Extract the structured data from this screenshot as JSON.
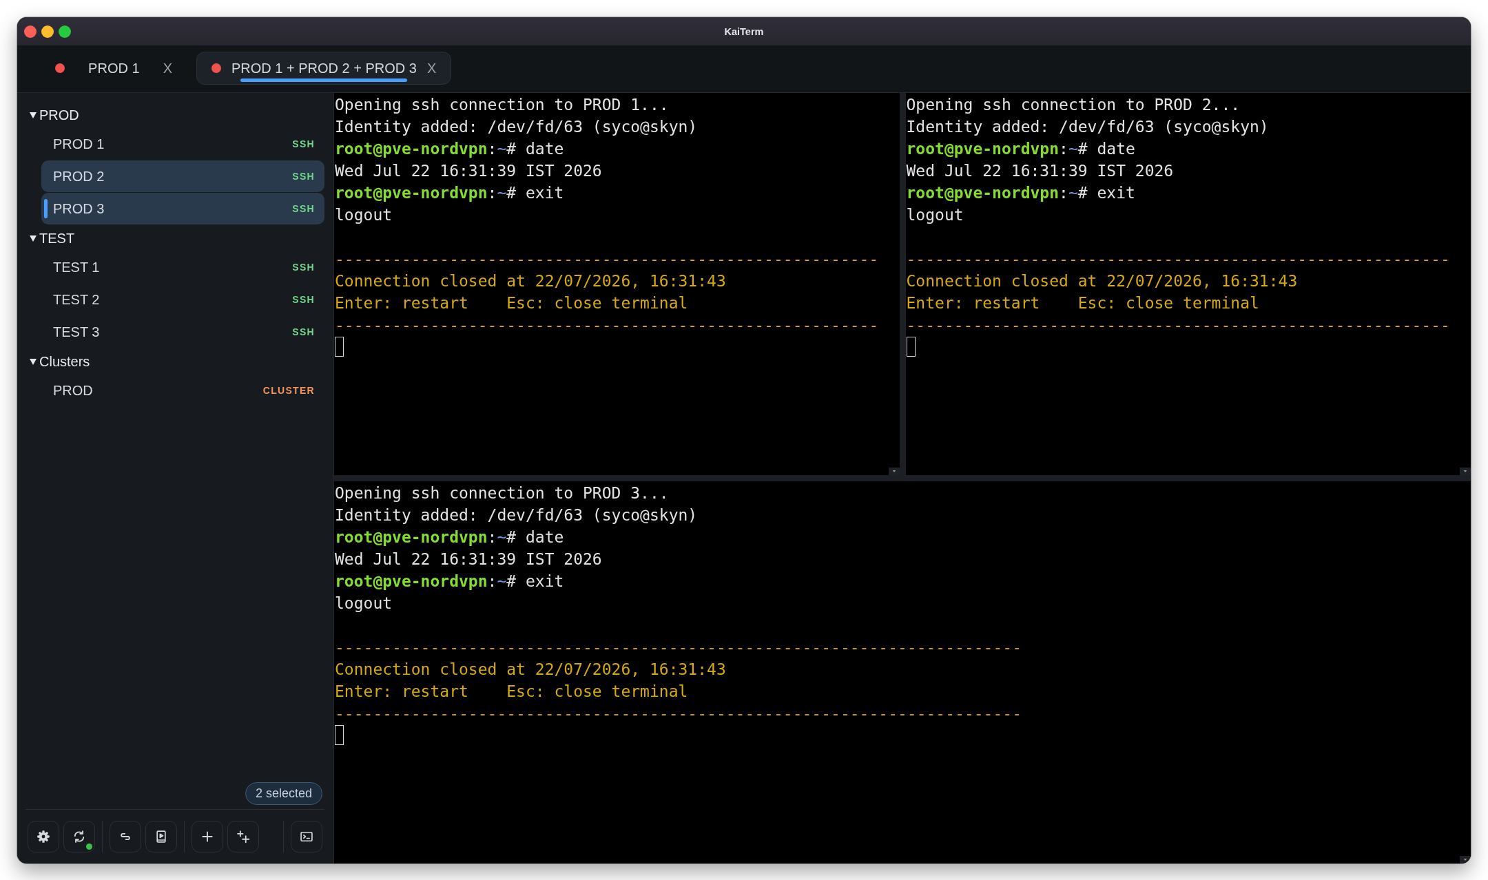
{
  "window": {
    "title": "KaiTerm"
  },
  "tabs": [
    {
      "label": "PROD 1",
      "connected": false,
      "selected": false,
      "close": "X"
    },
    {
      "label": "PROD 1 + PROD 2 + PROD 3",
      "connected": false,
      "selected": true,
      "close": "X"
    }
  ],
  "sidebar": {
    "groups": [
      {
        "label": "PROD",
        "expanded": true,
        "items": [
          {
            "label": "PROD 1",
            "badge": "SSH",
            "kind": "ssh",
            "selected": false,
            "active": false
          },
          {
            "label": "PROD 2",
            "badge": "SSH",
            "kind": "ssh",
            "selected": true,
            "active": false
          },
          {
            "label": "PROD 3",
            "badge": "SSH",
            "kind": "ssh",
            "selected": true,
            "active": true
          }
        ]
      },
      {
        "label": "TEST",
        "expanded": true,
        "items": [
          {
            "label": "TEST 1",
            "badge": "SSH",
            "kind": "ssh",
            "selected": false,
            "active": false
          },
          {
            "label": "TEST 2",
            "badge": "SSH",
            "kind": "ssh",
            "selected": false,
            "active": false
          },
          {
            "label": "TEST 3",
            "badge": "SSH",
            "kind": "ssh",
            "selected": false,
            "active": false
          }
        ]
      },
      {
        "label": "Clusters",
        "expanded": true,
        "items": [
          {
            "label": "PROD",
            "badge": "CLUSTER",
            "kind": "cluster",
            "selected": false,
            "active": false
          }
        ]
      }
    ],
    "selection_badge": "2 selected",
    "toolbar": {
      "sync_online": true
    }
  },
  "panes": [
    {
      "lines": [
        {
          "kind": "text",
          "segments": [
            {
              "kind": "plain",
              "text": "Opening ssh connection to PROD 1..."
            }
          ]
        },
        {
          "kind": "text",
          "segments": [
            {
              "kind": "plain",
              "text": "Identity added: /dev/fd/63 (syco@skyn)"
            }
          ]
        },
        {
          "kind": "text",
          "segments": [
            {
              "kind": "host",
              "text": "root@pve-nordvpn"
            },
            {
              "kind": "plain",
              "text": ":"
            },
            {
              "kind": "path",
              "text": "~"
            },
            {
              "kind": "plain",
              "text": "# date"
            }
          ]
        },
        {
          "kind": "text",
          "segments": [
            {
              "kind": "plain",
              "text": "Wed Jul 22 16:31:39 IST 2026"
            }
          ]
        },
        {
          "kind": "text",
          "segments": [
            {
              "kind": "host",
              "text": "root@pve-nordvpn"
            },
            {
              "kind": "plain",
              "text": ":"
            },
            {
              "kind": "path",
              "text": "~"
            },
            {
              "kind": "plain",
              "text": "# exit"
            }
          ]
        },
        {
          "kind": "text",
          "segments": [
            {
              "kind": "plain",
              "text": "logout"
            }
          ]
        },
        {
          "kind": "blank"
        },
        {
          "kind": "text",
          "segments": [
            {
              "kind": "notice",
              "text": "---------------------------------------------------------"
            }
          ]
        },
        {
          "kind": "text",
          "segments": [
            {
              "kind": "notice",
              "text": "Connection closed at 22/07/2026, 16:31:43"
            }
          ]
        },
        {
          "kind": "text",
          "segments": [
            {
              "kind": "notice",
              "text": "Enter: restart    Esc: close terminal"
            }
          ]
        },
        {
          "kind": "text",
          "segments": [
            {
              "kind": "notice",
              "text": "---------------------------------------------------------"
            }
          ]
        },
        {
          "kind": "cursor"
        }
      ]
    },
    {
      "lines": [
        {
          "kind": "text",
          "segments": [
            {
              "kind": "plain",
              "text": "Opening ssh connection to PROD 2..."
            }
          ]
        },
        {
          "kind": "text",
          "segments": [
            {
              "kind": "plain",
              "text": "Identity added: /dev/fd/63 (syco@skyn)"
            }
          ]
        },
        {
          "kind": "text",
          "segments": [
            {
              "kind": "host",
              "text": "root@pve-nordvpn"
            },
            {
              "kind": "plain",
              "text": ":"
            },
            {
              "kind": "path",
              "text": "~"
            },
            {
              "kind": "plain",
              "text": "# date"
            }
          ]
        },
        {
          "kind": "text",
          "segments": [
            {
              "kind": "plain",
              "text": "Wed Jul 22 16:31:39 IST 2026"
            }
          ]
        },
        {
          "kind": "text",
          "segments": [
            {
              "kind": "host",
              "text": "root@pve-nordvpn"
            },
            {
              "kind": "plain",
              "text": ":"
            },
            {
              "kind": "path",
              "text": "~"
            },
            {
              "kind": "plain",
              "text": "# exit"
            }
          ]
        },
        {
          "kind": "text",
          "segments": [
            {
              "kind": "plain",
              "text": "logout"
            }
          ]
        },
        {
          "kind": "blank"
        },
        {
          "kind": "text",
          "segments": [
            {
              "kind": "notice",
              "text": "---------------------------------------------------------"
            }
          ]
        },
        {
          "kind": "text",
          "segments": [
            {
              "kind": "notice",
              "text": "Connection closed at 22/07/2026, 16:31:43"
            }
          ]
        },
        {
          "kind": "text",
          "segments": [
            {
              "kind": "notice",
              "text": "Enter: restart    Esc: close terminal"
            }
          ]
        },
        {
          "kind": "text",
          "segments": [
            {
              "kind": "notice",
              "text": "---------------------------------------------------------"
            }
          ]
        },
        {
          "kind": "cursor"
        }
      ]
    },
    {
      "lines": [
        {
          "kind": "text",
          "segments": [
            {
              "kind": "plain",
              "text": "Opening ssh connection to PROD 3..."
            }
          ]
        },
        {
          "kind": "text",
          "segments": [
            {
              "kind": "plain",
              "text": "Identity added: /dev/fd/63 (syco@skyn)"
            }
          ]
        },
        {
          "kind": "text",
          "segments": [
            {
              "kind": "host",
              "text": "root@pve-nordvpn"
            },
            {
              "kind": "plain",
              "text": ":"
            },
            {
              "kind": "path",
              "text": "~"
            },
            {
              "kind": "plain",
              "text": "# date"
            }
          ]
        },
        {
          "kind": "text",
          "segments": [
            {
              "kind": "plain",
              "text": "Wed Jul 22 16:31:39 IST 2026"
            }
          ]
        },
        {
          "kind": "text",
          "segments": [
            {
              "kind": "host",
              "text": "root@pve-nordvpn"
            },
            {
              "kind": "plain",
              "text": ":"
            },
            {
              "kind": "path",
              "text": "~"
            },
            {
              "kind": "plain",
              "text": "# exit"
            }
          ]
        },
        {
          "kind": "text",
          "segments": [
            {
              "kind": "plain",
              "text": "logout"
            }
          ]
        },
        {
          "kind": "blank"
        },
        {
          "kind": "text",
          "segments": [
            {
              "kind": "notice",
              "text": "------------------------------------------------------------------------"
            }
          ]
        },
        {
          "kind": "text",
          "segments": [
            {
              "kind": "notice",
              "text": "Connection closed at 22/07/2026, 16:31:43"
            }
          ]
        },
        {
          "kind": "text",
          "segments": [
            {
              "kind": "notice",
              "text": "Enter: restart    Esc: close terminal"
            }
          ]
        },
        {
          "kind": "text",
          "segments": [
            {
              "kind": "notice",
              "text": "------------------------------------------------------------------------"
            }
          ]
        },
        {
          "kind": "cursor"
        }
      ]
    }
  ]
}
